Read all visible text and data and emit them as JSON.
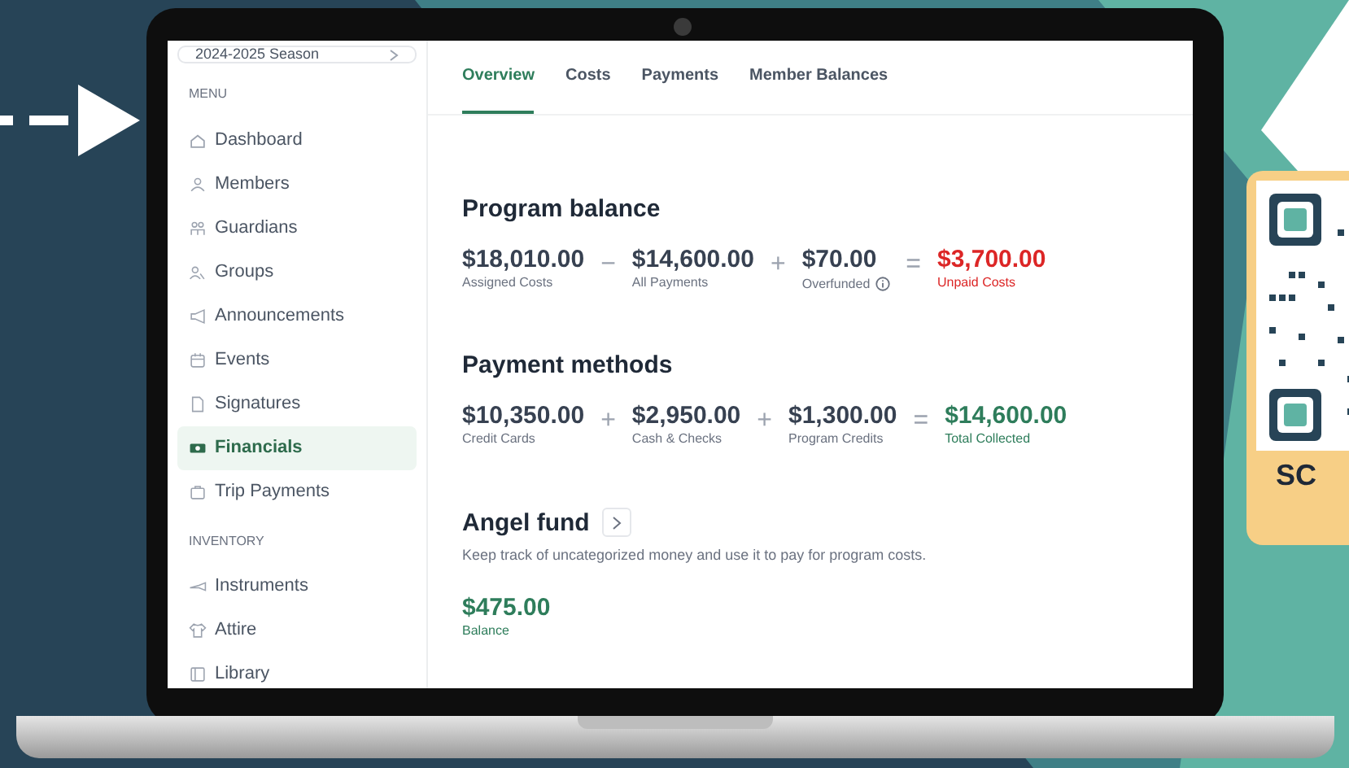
{
  "season": {
    "label": "2024-2025 Season"
  },
  "sidebar": {
    "sections": [
      {
        "heading": "MENU",
        "items": [
          {
            "label": "Dashboard",
            "selected": false
          },
          {
            "label": "Members",
            "selected": false
          },
          {
            "label": "Guardians",
            "selected": false
          },
          {
            "label": "Groups",
            "selected": false
          },
          {
            "label": "Announcements",
            "selected": false
          },
          {
            "label": "Events",
            "selected": false
          },
          {
            "label": "Signatures",
            "selected": false
          },
          {
            "label": "Financials",
            "selected": true
          },
          {
            "label": "Trip Payments",
            "selected": false
          }
        ]
      },
      {
        "heading": "INVENTORY",
        "items": [
          {
            "label": "Instruments",
            "selected": false
          },
          {
            "label": "Attire",
            "selected": false
          },
          {
            "label": "Library",
            "selected": false
          }
        ]
      }
    ]
  },
  "tabs": [
    {
      "label": "Overview",
      "selected": true
    },
    {
      "label": "Costs",
      "selected": false
    },
    {
      "label": "Payments",
      "selected": false
    },
    {
      "label": "Member Balances",
      "selected": false
    }
  ],
  "program_balance": {
    "title": "Program balance",
    "terms": [
      {
        "amount": "$18,010.00",
        "label": "Assigned Costs",
        "color": "#374151",
        "info": false
      },
      {
        "operator": "−",
        "amount": "$14,600.00",
        "label": "All Payments",
        "color": "#374151",
        "info": false
      },
      {
        "operator": "+",
        "amount": "$70.00",
        "label": "Overfunded",
        "color": "#374151",
        "info": true
      },
      {
        "operator": "=",
        "amount": "$3,700.00",
        "label": "Unpaid Costs",
        "color": "#dc2626",
        "info": false
      }
    ]
  },
  "payment_methods": {
    "title": "Payment methods",
    "terms": [
      {
        "amount": "$10,350.00",
        "label": "Credit Cards",
        "color": "#374151",
        "info": false
      },
      {
        "operator": "+",
        "amount": "$2,950.00",
        "label": "Cash & Checks",
        "color": "#374151",
        "info": false
      },
      {
        "operator": "+",
        "amount": "$1,300.00",
        "label": "Program Credits",
        "color": "#374151",
        "info": false
      },
      {
        "operator": "=",
        "amount": "$14,600.00",
        "label": "Total Collected",
        "color": "#2e7d5b",
        "info": false
      }
    ]
  },
  "angel_fund": {
    "title": "Angel fund",
    "description": "Keep track of uncategorized money and use it to pay for program costs.",
    "amount": "$475.00",
    "label": "Balance"
  },
  "qr_badge": {
    "caption": "SC"
  }
}
